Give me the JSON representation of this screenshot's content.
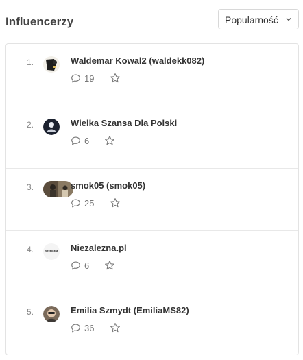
{
  "header": {
    "title": "Influencerzy",
    "sort_label": "Popularność"
  },
  "influencers": [
    {
      "rank": "1.",
      "name": "Waldemar Kowal2 (waldekk082)",
      "comments": "19",
      "avatar_icon": "dark-photo-avatar"
    },
    {
      "rank": "2.",
      "name": "Wielka Szansa Dla Polski",
      "comments": "6",
      "avatar_icon": "logo-avatar"
    },
    {
      "rank": "3.",
      "name": "smok05 (smok05)",
      "comments": "25",
      "avatar_icon": "photo-avatar"
    },
    {
      "rank": "4.",
      "name": "Niezalezna.pl",
      "comments": "6",
      "avatar_icon": "niezalezna-logo-avatar",
      "avatar_text": "niezalezna"
    },
    {
      "rank": "5.",
      "name": "Emilia Szmydt (EmiliaMS82)",
      "comments": "36",
      "avatar_icon": "portrait-avatar"
    }
  ],
  "colors": {
    "border": "#e3e3e3",
    "text": "#333333",
    "muted": "#888888",
    "icon": "#777777"
  }
}
